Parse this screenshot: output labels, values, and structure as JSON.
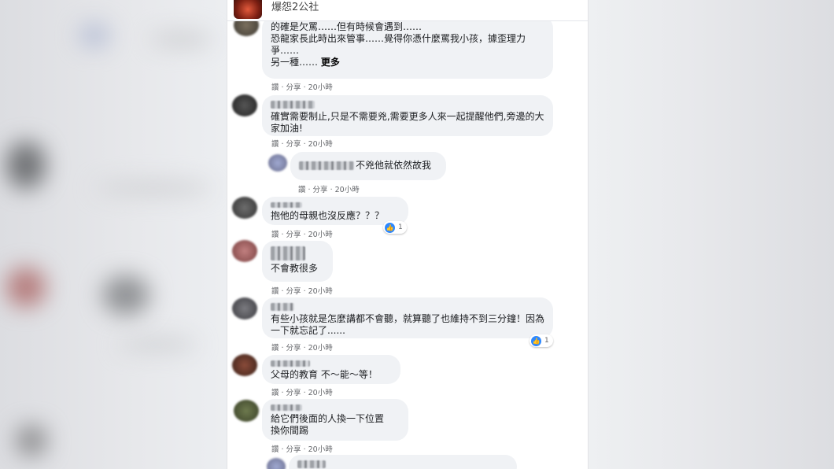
{
  "header": {
    "page_name": "爆怨2公社"
  },
  "comments": [
    {
      "text": "的確是欠罵……但有時候會遇到……\n恐龍家長此時出來管事……覺得你憑什麼罵我小孩，據歪理力爭……\n另一種……",
      "more": "更多",
      "meta": "讚 · 分享 · 20小時"
    },
    {
      "text": "確實需要制止,只是不需要兇,需要更多人來一起提醒他們,旁邊的大家加油!",
      "meta": "讚 · 分享 · 20小時"
    },
    {
      "text": "不兇他就依然故我",
      "meta": "讚 · 分享 · 20小時"
    },
    {
      "text": "抱他的母親也沒反應？？？",
      "meta": "讚 · 分享 · 20小時",
      "reaction": "1"
    },
    {
      "text": "不會教很多",
      "meta": "讚 · 分享 · 20小時"
    },
    {
      "text": "有些小孩就是怎麼講都不會聽，就算聽了也維持不到三分鐘！因為一下就忘記了......",
      "meta": "讚 · 分享 · 20小時",
      "reaction": "1"
    },
    {
      "text": "父母的教育 不～能～等！",
      "meta": "讚 · 分享 · 20小時"
    },
    {
      "text": "給它們後面的人換一下位置\n換你間踢",
      "meta": "讚 · 分享 · 20小時"
    }
  ],
  "colors": {
    "like_blue": "#2d88ff",
    "bubble": "#f0f2f5",
    "meta_grey": "#65676b"
  }
}
